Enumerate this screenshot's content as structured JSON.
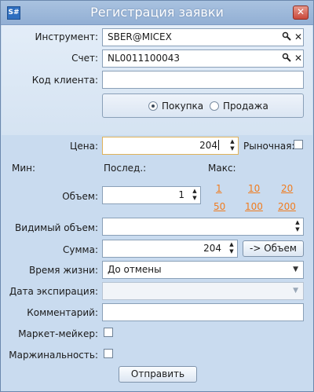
{
  "window": {
    "app_icon": "S#",
    "title": "Регистрация заявки",
    "close_glyph": "✕"
  },
  "form": {
    "instrument": {
      "label": "Инструмент:",
      "value": "SBER@MICEX"
    },
    "account": {
      "label": "Счет:",
      "value": "NL0011100043"
    },
    "client_code": {
      "label": "Код клиента:",
      "value": ""
    },
    "side": {
      "buy": "Покупка",
      "sell": "Продажа",
      "selected": "buy"
    },
    "price": {
      "label": "Цена:",
      "value": "204",
      "market_label": "Рыночная:"
    },
    "stats": {
      "min": "Мин:",
      "last": "Послед.:",
      "max": "Макс:"
    },
    "volume": {
      "label": "Объем:",
      "value": "1"
    },
    "quick_volumes": [
      "1",
      "10",
      "20",
      "50",
      "100",
      "200"
    ],
    "visible_volume": {
      "label": "Видимый объем:",
      "value": ""
    },
    "sum": {
      "label": "Сумма:",
      "value": "204",
      "to_volume_button": "-> Объем"
    },
    "lifetime": {
      "label": "Время жизни:",
      "value": "До отмены"
    },
    "expiration": {
      "label": "Дата экспирация:",
      "value": ""
    },
    "comment": {
      "label": "Комментарий:",
      "value": ""
    },
    "market_maker": {
      "label": "Маркет-мейкер:"
    },
    "margin": {
      "label": "Маржинальность:"
    },
    "submit": "Отправить"
  },
  "icons": {
    "search": "search-icon",
    "clear": "clear-icon"
  },
  "colors": {
    "title_bar": "#9ab6d9",
    "link": "#f07c1f",
    "close": "#c9483a"
  }
}
